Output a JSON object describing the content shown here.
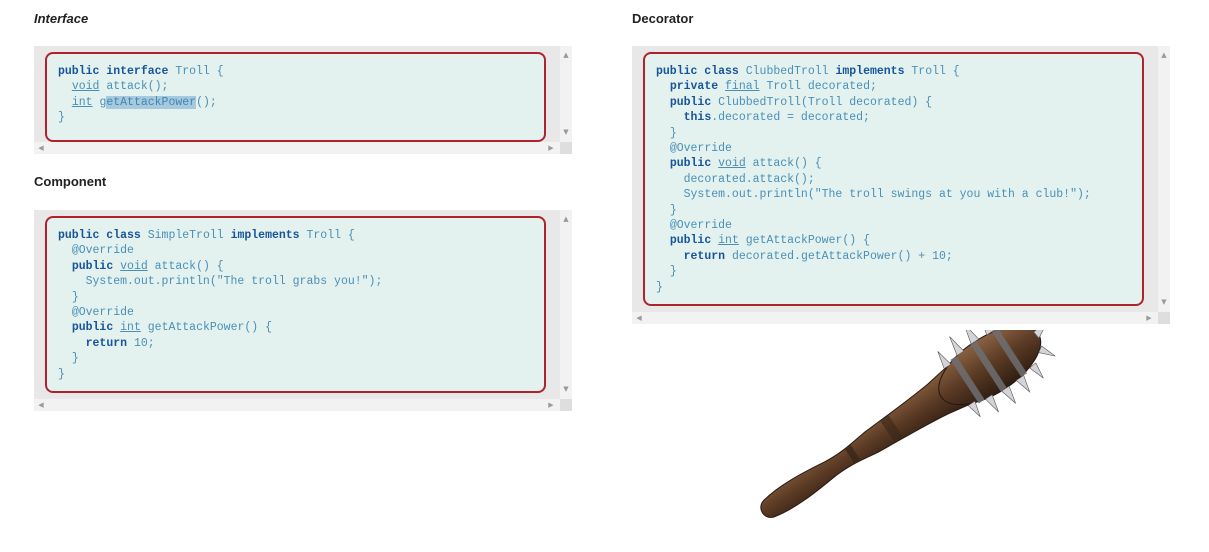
{
  "sections": {
    "interface": {
      "heading": "Interface",
      "code": [
        "public interface Troll {",
        "  void attack();",
        "  int getAttackPower();",
        "}"
      ]
    },
    "component": {
      "heading": "Component",
      "code": [
        "public class SimpleTroll implements Troll {",
        "  @Override",
        "  public void attack() {",
        "    System.out.println(\"The troll grabs you!\");",
        "  }",
        "  @Override",
        "  public int getAttackPower() {",
        "    return 10;",
        "  }",
        "}"
      ]
    },
    "decorator": {
      "heading": "Decorator",
      "code": [
        "public class ClubbedTroll implements Troll {",
        "  private final Troll decorated;",
        "  public ClubbedTroll(Troll decorated) {",
        "    this.decorated = decorated;",
        "  }",
        "  @Override",
        "  public void attack() {",
        "    decorated.attack();",
        "    System.out.println(\"The troll swings at you with a club!\");",
        "  }",
        "  @Override",
        "  public int getAttackPower() {",
        "    return decorated.getAttackPower() + 10;",
        "  }",
        "}"
      ]
    }
  },
  "image": {
    "subject": "spiked-club"
  },
  "scroll_arrows": {
    "up": "▲",
    "down": "▼",
    "left": "◀",
    "right": "▶"
  },
  "colors": {
    "keyword": "#17549a",
    "code_text": "#4a8fb8",
    "frame_border": "#b0222c",
    "frame_fill": "#e3f2ee",
    "selection": "#a7c9de"
  }
}
